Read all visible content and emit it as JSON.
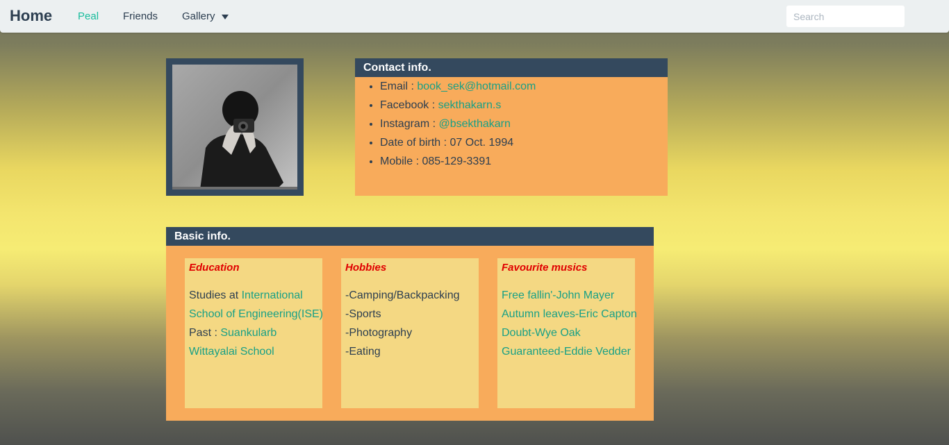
{
  "nav": {
    "brand": "Home",
    "links": [
      "Peal",
      "Friends",
      "Gallery"
    ],
    "active": "Peal",
    "search_placeholder": "Search"
  },
  "photo": {
    "description_icon": "profile-photo-person-with-camera"
  },
  "contact": {
    "title": "Contact info.",
    "items": [
      {
        "label": "Email : ",
        "value": "book_sek@hotmail.com",
        "link": true
      },
      {
        "label": "Facebook : ",
        "value": "sekthakarn.s",
        "link": true
      },
      {
        "label": "Instagram : ",
        "value": "@bsekthakarn",
        "link": true
      },
      {
        "label": "Date of birth : ",
        "value": "07 Oct. 1994",
        "link": false
      },
      {
        "label": "Mobile : ",
        "value": "085-129-3391",
        "link": false
      }
    ]
  },
  "basic": {
    "title": "Basic info.",
    "education": {
      "title": "Education",
      "studies_prefix": "Studies at ",
      "studies_line1": "International",
      "studies_line2": "School of Engineering(ISE)",
      "past_prefix": "Past : ",
      "past_line1": "Suankularb",
      "past_line2": "Wittayalai School"
    },
    "hobbies": {
      "title": "Hobbies",
      "items": [
        "-Camping/Backpacking",
        "-Sports",
        "-Photography",
        "-Eating"
      ]
    },
    "music": {
      "title": "Favourite musics",
      "items": [
        "Free fallin'-John Mayer",
        "Autumn leaves-Eric Capton",
        "Doubt-Wye Oak",
        "Guaranteed-Eddie Vedder"
      ]
    }
  },
  "colors": {
    "navy": "#34495e",
    "orange": "#f8ab5b",
    "card": "#f4d883",
    "link": "#18a086",
    "title_red": "#e00000"
  }
}
